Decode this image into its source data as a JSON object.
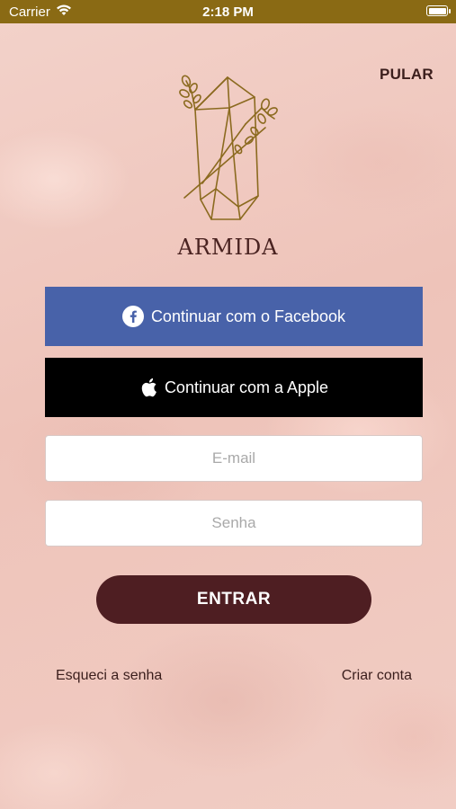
{
  "status_bar": {
    "carrier": "Carrier",
    "time": "2:18 PM",
    "icons": [
      "wifi-icon",
      "battery-icon"
    ]
  },
  "header": {
    "skip_label": "PULAR"
  },
  "brand": {
    "name": "ARMIDA",
    "logo_icon": "crystal-flower-logo"
  },
  "social": {
    "facebook_label": "Continuar com o Facebook",
    "facebook_icon": "facebook-icon",
    "apple_label": "Continuar com a Apple",
    "apple_icon": "apple-icon"
  },
  "form": {
    "email_placeholder": "E-mail",
    "email_value": "",
    "password_placeholder": "Senha",
    "password_value": "",
    "login_label": "ENTRAR"
  },
  "links": {
    "forgot_password": "Esqueci a senha",
    "create_account": "Criar conta"
  },
  "colors": {
    "status_bar": "#8a6a14",
    "background": "#f0cbc2",
    "facebook": "#4862a9",
    "apple": "#000000",
    "login_button": "#4e1e22",
    "logo_gold": "#8b6a1f"
  }
}
